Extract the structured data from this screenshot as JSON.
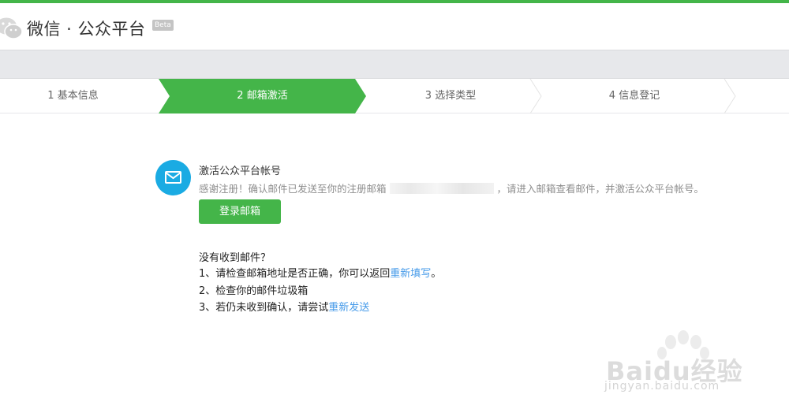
{
  "colors": {
    "accent": "#44b549",
    "mail_icon_bg": "#1aabe3",
    "link": "#459ae9"
  },
  "header": {
    "logo_icon": "wechat-logo-icon",
    "title": "微信 · 公众平台",
    "badge": "Beta"
  },
  "steps": [
    {
      "label": "1 基本信息",
      "active": false
    },
    {
      "label": "2 邮箱激活",
      "active": true
    },
    {
      "label": "3 选择类型",
      "active": false
    },
    {
      "label": "4 信息登记",
      "active": false
    }
  ],
  "activation": {
    "icon": "mail-icon",
    "title": "激活公众平台帐号",
    "desc_before": "感谢注册！确认邮件已发送至你的注册邮箱",
    "desc_after": "，请进入邮箱查看邮件，并激活公众平台帐号。",
    "button": "登录邮箱"
  },
  "help": {
    "question": "没有收到邮件？",
    "item1_text": "1、请检查邮箱地址是否正确，你可以返回",
    "item1_link": "重新填写",
    "item1_end": "。",
    "item2_text": "2、检查你的邮件垃圾箱",
    "item3_text": "3、若仍未收到确认，请尝试",
    "item3_link": "重新发送"
  },
  "watermark": {
    "text": "Baidu经验",
    "url": "jingyan.baidu.com"
  }
}
